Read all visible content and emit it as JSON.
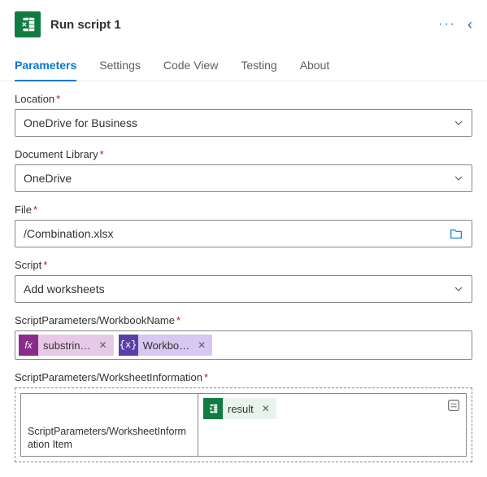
{
  "header": {
    "title": "Run script 1"
  },
  "tabs": [
    {
      "label": "Parameters",
      "active": true
    },
    {
      "label": "Settings"
    },
    {
      "label": "Code View"
    },
    {
      "label": "Testing"
    },
    {
      "label": "About"
    }
  ],
  "fields": {
    "location": {
      "label": "Location",
      "value": "OneDrive for Business"
    },
    "library": {
      "label": "Document Library",
      "value": "OneDrive"
    },
    "file": {
      "label": "File",
      "value": "/Combination.xlsx"
    },
    "script": {
      "label": "Script",
      "value": "Add worksheets"
    },
    "workbookName": {
      "label": "ScriptParameters/WorkbookName",
      "tokens": {
        "fx": {
          "icon": "fx",
          "label": "substrin…"
        },
        "var": {
          "icon": "{x}",
          "label": "Workbo…"
        }
      }
    },
    "worksheetInfo": {
      "label": "ScriptParameters/WorksheetInformation",
      "itemLabel": "ScriptParameters/WorksheetInformation Item",
      "token": {
        "label": "result"
      }
    }
  },
  "glyphs": {
    "close": "✕"
  }
}
